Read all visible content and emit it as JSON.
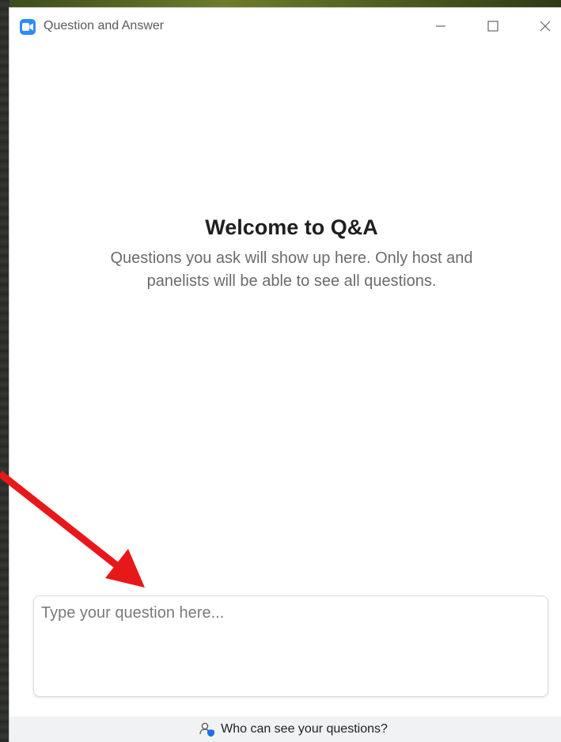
{
  "window": {
    "title": "Question and Answer",
    "app_icon": "zoom-camera-icon",
    "controls": [
      "minimize-icon",
      "maximize-icon",
      "close-icon"
    ]
  },
  "main": {
    "heading": "Welcome to Q&A",
    "subtext": "Questions you ask will show up here. Only host and panelists will be able to see all questions."
  },
  "question_input": {
    "placeholder": "Type your question here...",
    "value": ""
  },
  "footer": {
    "link_label": "Who can see your questions?",
    "icon": "user-shield-icon"
  },
  "annotation": {
    "type": "arrow",
    "color": "#e8181a"
  },
  "colors": {
    "accent": "#2d8cff",
    "footer_bg": "#f1f2f4"
  }
}
